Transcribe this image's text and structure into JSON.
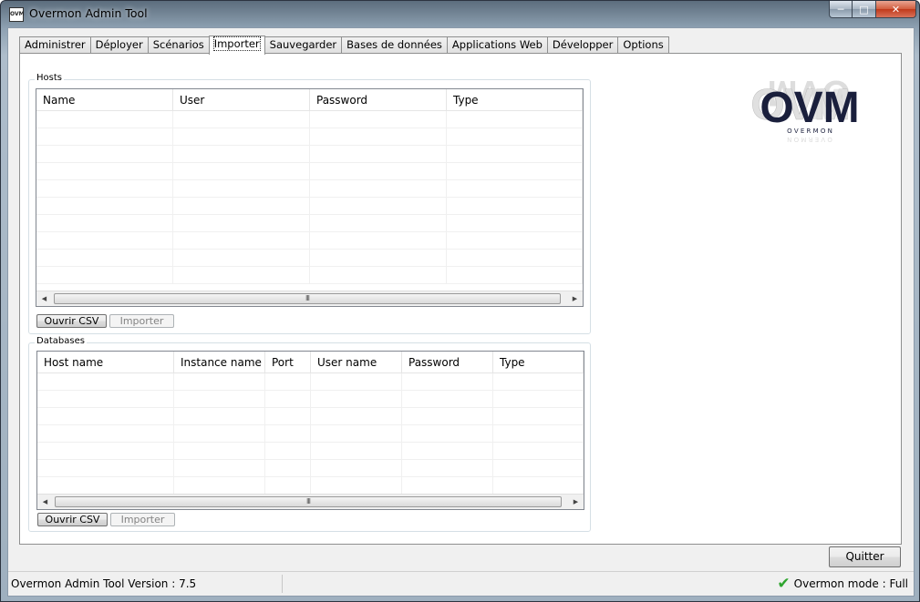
{
  "window": {
    "title": "Overmon Admin Tool",
    "icon_text": "OVM",
    "min_glyph": "─",
    "max_glyph": "□",
    "close_glyph": "✕"
  },
  "tabs": [
    "Administrer",
    "Déployer",
    "Scénarios",
    "Importer",
    "Sauvegarder",
    "Bases de données",
    "Applications Web",
    "Développer",
    "Options"
  ],
  "active_tab": "Importer",
  "hosts": {
    "group_label": "Hosts",
    "columns": [
      "Name",
      "User",
      "Password",
      "Type"
    ],
    "open_button": "Ouvrir CSV",
    "import_button": "Importer"
  },
  "databases": {
    "group_label": "Databases",
    "columns": [
      "Host name",
      "Instance name",
      "Port",
      "User name",
      "Password",
      "Type"
    ],
    "open_button": "Ouvrir CSV",
    "import_button": "Importer"
  },
  "scroll": {
    "left_icon": "arrow-left-icon",
    "right_icon": "arrow-right-icon",
    "grip": "III"
  },
  "logo": {
    "text": "OVM",
    "subtitle": "O V E R M O N"
  },
  "quit_button": "Quitter",
  "status": {
    "version": "Overmon Admin Tool Version : 7.5",
    "mode": "Overmon mode : Full",
    "mode_icon": "check-icon",
    "check_glyph": "✔"
  },
  "colors": {
    "logo_text": "#1a1f3c",
    "check": "#2fa52f"
  }
}
